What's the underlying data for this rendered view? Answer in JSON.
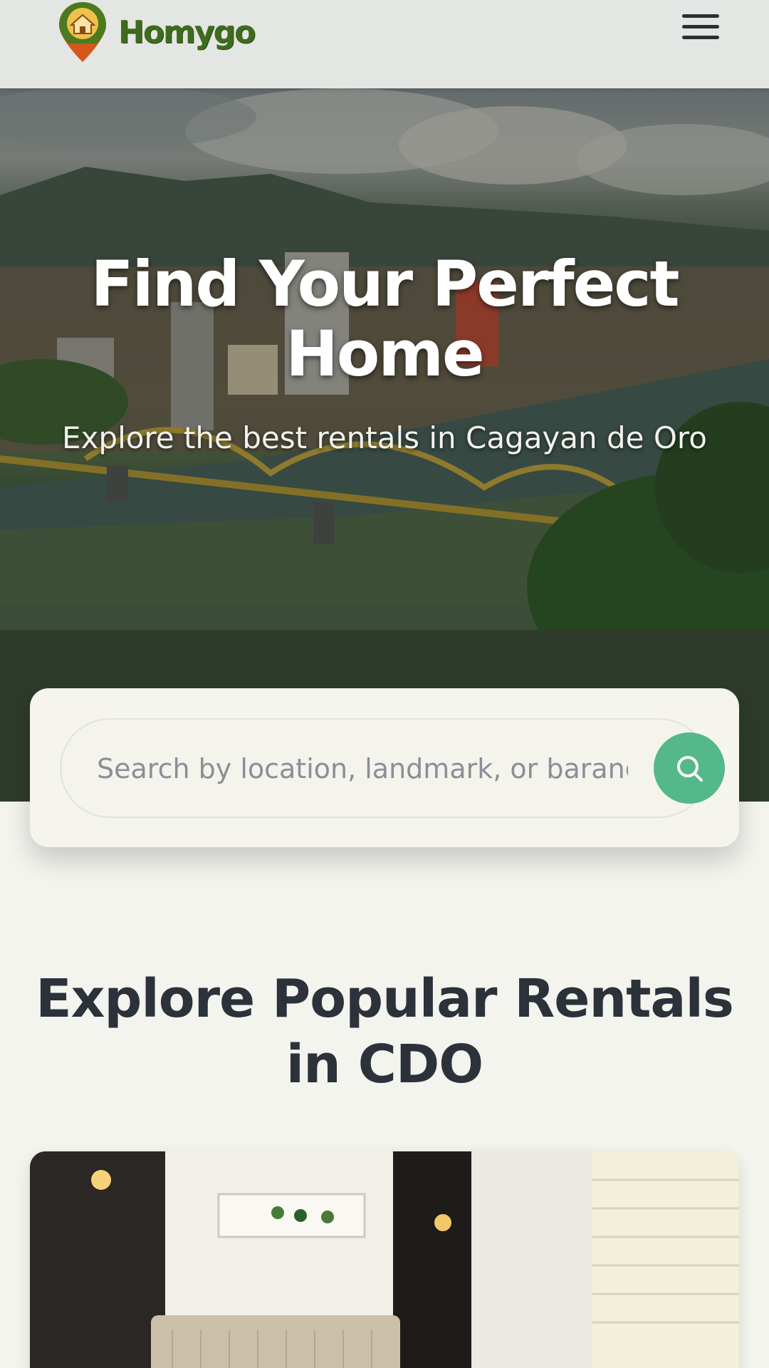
{
  "header": {
    "brand": "Homygo",
    "menu_icon": "hamburger-menu-icon"
  },
  "hero": {
    "title": "Find Your Perfect Home",
    "subtitle": "Explore the best rentals in Cagayan de Oro"
  },
  "search": {
    "placeholder": "Search by location, landmark, or barangay",
    "button_icon": "search-icon"
  },
  "popular": {
    "title": "Explore Popular Rentals in CDO"
  },
  "colors": {
    "brand_green": "#3f6b1e",
    "accent_green": "#55b88a",
    "pin_orange": "#d4571c",
    "heading": "#2b323a"
  }
}
